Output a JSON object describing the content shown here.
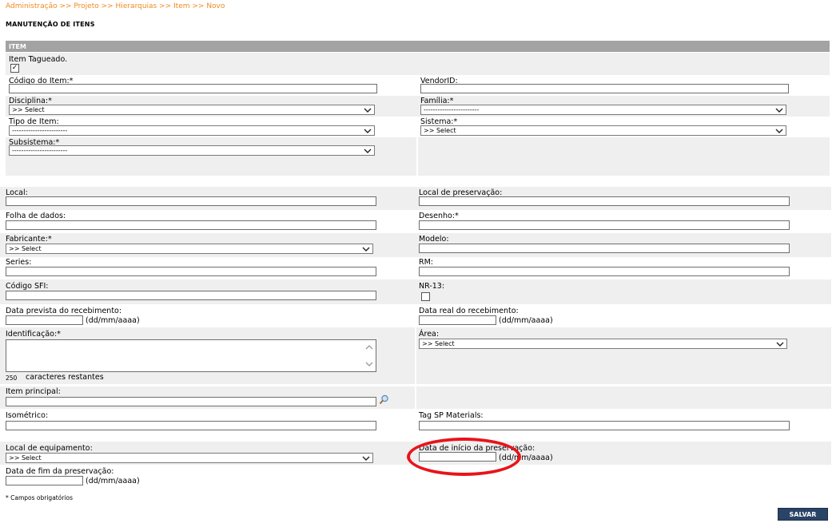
{
  "breadcrumb": "Administração >> Projeto >> Hierarquias >> Item >> Novo",
  "page_title": "MANUTENÇÃO DE ITENS",
  "section_header": "ITEM",
  "colors": {
    "breadcrumb": "#f08a1e",
    "header": "#a3a3a3",
    "band": "#efefef",
    "save_button": "#2a4466",
    "highlight": "#e8141b"
  },
  "item_section": {
    "item_tagueado_label": "Item Tagueado.",
    "item_tagueado_checked": true,
    "checkmark": "✓",
    "codigo_item_label": "Código do Item:*",
    "vendor_id_label": "VendorID:",
    "disciplina_label": "Disciplina:*",
    "disciplina_value": ">> Select",
    "familia_label": "Família:*",
    "familia_value": "------------------------",
    "tipo_item_label": "Tipo de Item:",
    "tipo_item_value": "------------------------",
    "sistema_label": "Sistema:*",
    "sistema_value": ">> Select",
    "subsistema_label": "Subsistema:*",
    "subsistema_value": "------------------------"
  },
  "details": {
    "local_label": "Local:",
    "local_preservacao_label": "Local de preservação:",
    "folha_dados_label": "Folha de dados:",
    "desenho_label": "Desenho:*",
    "fabricante_label": "Fabricante:*",
    "fabricante_value": ">> Select",
    "modelo_label": "Modelo:",
    "series_label": "Series:",
    "rm_label": "RM:",
    "codigo_sfi_label": "Código SFI:",
    "nr13_label": "NR-13:",
    "data_prevista_label": "Data prevista do recebimento:",
    "data_real_label": "Data real do recebimento:",
    "date_format_hint": "(dd/mm/aaaa)",
    "identificacao_label": "Identificação:*",
    "chars_remaining_count": "250",
    "chars_remaining_label": "caracteres restantes",
    "area_label": "Área:",
    "area_value": ">> Select",
    "item_principal_label": "Item principal:",
    "isometrico_label": "Isométrico:",
    "tag_sp_label": "Tag SP Materials:",
    "local_equipamento_label": "Local de equipamento:",
    "local_equipamento_value": ">> Select",
    "data_inicio_preservacao_label": "Data de início da preservação:",
    "data_fim_preservacao_label": "Data de fim da preservação:"
  },
  "footnote": "* Campos obrigatórios",
  "save_button_label": "SALVAR"
}
